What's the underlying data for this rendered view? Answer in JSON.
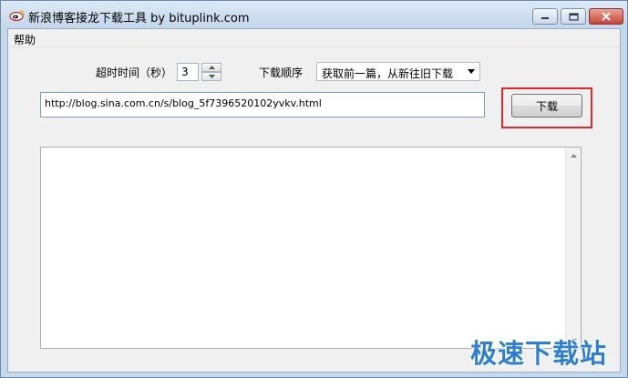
{
  "window": {
    "title": "新浪博客接龙下载工具 by bituplink.com",
    "icon": "sina-logo-icon",
    "controls": [
      "minimize-icon",
      "maximize-icon",
      "close-icon"
    ]
  },
  "menu": {
    "items": [
      {
        "label": "帮助"
      }
    ]
  },
  "settings": {
    "timeout_label": "超时时间（秒）",
    "timeout_value": "3",
    "order_label": "下载顺序",
    "order_selected": "获取前一篇，从新往旧下载"
  },
  "url_input": {
    "value": "http://blog.sina.com.cn/s/blog_5f7396520102yvkv.html"
  },
  "download_button": {
    "label": "下载",
    "highlight_color": "#e02a2a"
  },
  "log": {
    "content": ""
  },
  "watermark": {
    "text": "极速下载站",
    "color": "#2f7fd0"
  }
}
